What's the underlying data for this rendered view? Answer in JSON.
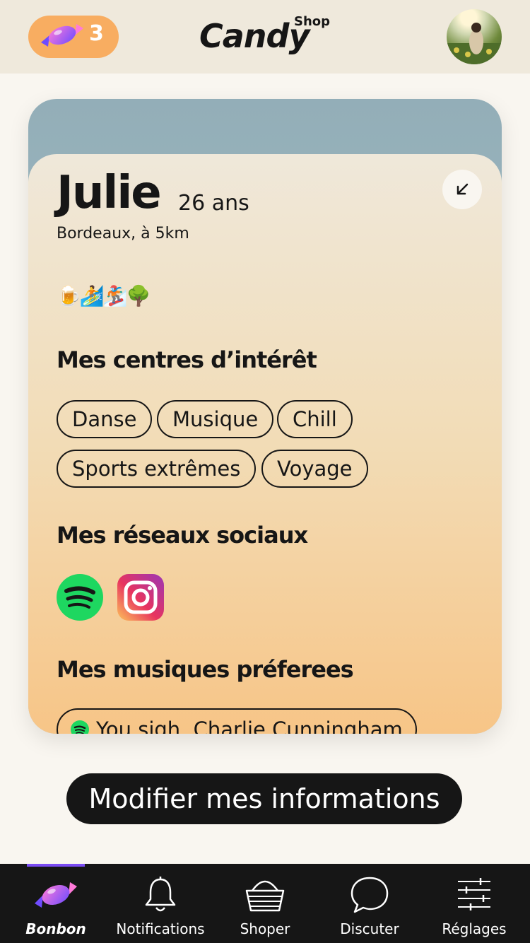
{
  "header": {
    "candy_count": "3",
    "logo_word": "Candy",
    "logo_sup": "Shop"
  },
  "profile": {
    "name": "Julie",
    "age": "26 ans",
    "location": "Bordeaux, à 5km",
    "emojis": "🍺🏄🏂🌳"
  },
  "sections": {
    "interests_title": "Mes centres d’intérêt",
    "socials_title": "Mes réseaux sociaux",
    "music_title": "Mes musiques préferees"
  },
  "interests": [
    "Danse",
    "Musique",
    "Chill",
    "Sports extrêmes",
    "Voyage"
  ],
  "socials": [
    {
      "name": "spotify-icon",
      "color": "#1ed760"
    },
    {
      "name": "instagram-icon",
      "color": "#d6249f"
    }
  ],
  "song": "You sigh, Charlie Cunningham",
  "cta_label": "Modifier mes informations",
  "tabs": [
    {
      "label": "Bonbon",
      "icon": "candy-icon",
      "active": true
    },
    {
      "label": "Notifications",
      "icon": "bell-icon"
    },
    {
      "label": "Shoper",
      "icon": "basket-icon"
    },
    {
      "label": "Discuter",
      "icon": "chat-icon"
    },
    {
      "label": "Réglages",
      "icon": "sliders-icon"
    }
  ],
  "colors": {
    "accent": "#7b4cf3",
    "badge": "#f8ad61",
    "dark": "#161616"
  }
}
